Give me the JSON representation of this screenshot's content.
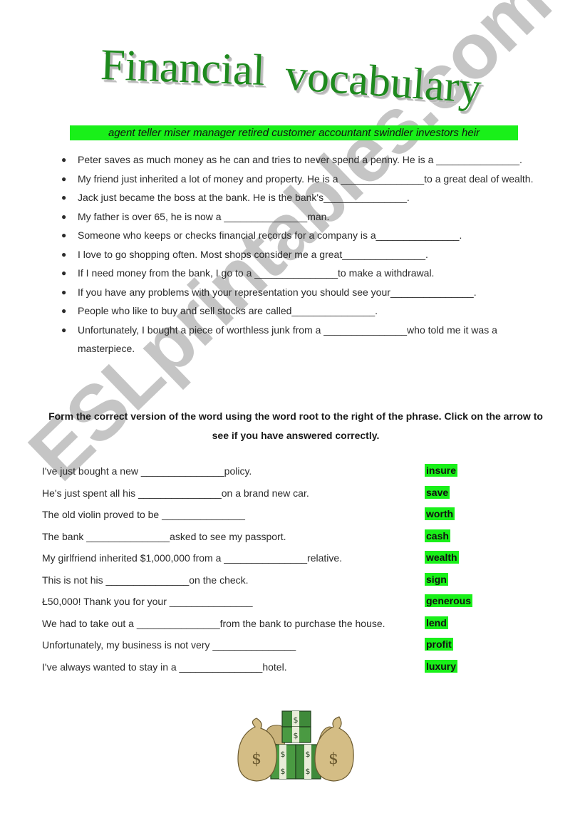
{
  "title": {
    "word1": "Financial",
    "word2": "vocabulary"
  },
  "word_bank": "agent teller miser manager retired customer accountant swindler investors heir",
  "bullets": [
    "Peter saves as much money as he can and tries to never spend a penny. He is a _______________.",
    "My friend just inherited a lot of money and property. He is a _______________to a great deal of wealth.",
    "Jack just became the boss at the bank. He is the bank's_______________.",
    "My father is over 65, he is now a _______________man.",
    "Someone who keeps or checks financial records for a company is a_______________.",
    "I love to go shopping often. Most shops consider me a great_______________.",
    "If I need money from the bank, I go to a _______________to make a withdrawal.",
    "If you have any problems with your representation you should see your_______________.",
    "People who like to buy and sell stocks are called_______________.",
    "Unfortunately, I bought a piece of worthless junk from a _______________who told me it was a masterpiece."
  ],
  "instructions": "Form the correct version of the word using the word root to the right of the phrase. Click on the arrow to see if you have answered correctly.",
  "exercises": [
    {
      "sentence": "I've just bought a new _______________policy.",
      "root": "insure"
    },
    {
      "sentence": "He's just spent all his _______________on a brand new car.",
      "root": "save"
    },
    {
      "sentence": "The old violin proved to be _______________",
      "root": "worth"
    },
    {
      "sentence": "The bank _______________asked to see my passport.",
      "root": "cash"
    },
    {
      "sentence": "My girlfriend inherited $1,000,000 from a _______________relative.",
      "root": "wealth"
    },
    {
      "sentence": "This is not his _______________on the check.",
      "root": "sign"
    },
    {
      "sentence": "Ł50,000! Thank you for your _______________",
      "root": "generous"
    },
    {
      "sentence": "We had to take out a _______________from the bank to purchase the house.",
      "root": "lend"
    },
    {
      "sentence": "Unfortunately, my business is not very _______________",
      "root": "profit"
    },
    {
      "sentence": "I've always wanted to stay in a _______________hotel.",
      "root": "luxury"
    }
  ],
  "watermark": "ESLprintables.com",
  "colors": {
    "title_green": "#1e8a1e",
    "highlight_green": "#19f019"
  },
  "illustration": "money-bags-and-cash-stacks"
}
